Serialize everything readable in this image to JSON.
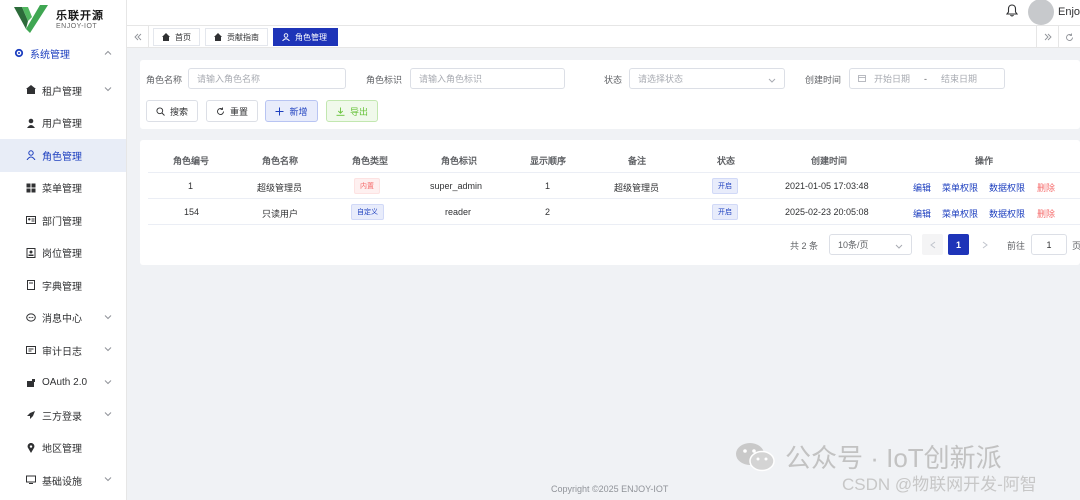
{
  "app": {
    "logo_title": "乐联开源",
    "logo_sub": "ENJOY-IOT",
    "brand_color": "#1e34b8",
    "user_name": "Enjoy"
  },
  "sidebar": {
    "group_label": "系统管理",
    "items": [
      {
        "label": "租户管理",
        "icon": "building-icon",
        "chevron": true
      },
      {
        "label": "用户管理",
        "icon": "user-icon",
        "chevron": false
      },
      {
        "label": "角色管理",
        "icon": "user-outline-icon",
        "chevron": false,
        "active": true
      },
      {
        "label": "菜单管理",
        "icon": "grid-icon",
        "chevron": false
      },
      {
        "label": "部门管理",
        "icon": "id-card-icon",
        "chevron": false
      },
      {
        "label": "岗位管理",
        "icon": "badge-icon",
        "chevron": false
      },
      {
        "label": "字典管理",
        "icon": "book-icon",
        "chevron": false
      },
      {
        "label": "消息中心",
        "icon": "chat-icon",
        "chevron": true
      },
      {
        "label": "审计日志",
        "icon": "log-icon",
        "chevron": true
      },
      {
        "label": "OAuth 2.0",
        "icon": "key-icon",
        "chevron": true
      },
      {
        "label": "三方登录",
        "icon": "rocket-icon",
        "chevron": true
      },
      {
        "label": "地区管理",
        "icon": "location-icon",
        "chevron": false
      },
      {
        "label": "基础设施",
        "icon": "monitor-icon",
        "chevron": true
      }
    ]
  },
  "tabs": [
    {
      "label": "首页"
    },
    {
      "label": "贡献指南"
    },
    {
      "label": "角色管理",
      "active": true
    }
  ],
  "search": {
    "name_label": "角色名称",
    "name_placeholder": "请输入角色名称",
    "code_label": "角色标识",
    "code_placeholder": "请输入角色标识",
    "status_label": "状态",
    "status_placeholder": "请选择状态",
    "time_label": "创建时间",
    "start_placeholder": "开始日期",
    "range_sep": "-",
    "end_placeholder": "结束日期",
    "btn_search": "搜索",
    "btn_reset": "重置",
    "btn_add": "新增",
    "btn_export": "导出"
  },
  "table": {
    "headers": [
      "角色编号",
      "角色名称",
      "角色类型",
      "角色标识",
      "显示顺序",
      "备注",
      "状态",
      "创建时间",
      "操作"
    ],
    "rows": [
      {
        "id": "1",
        "name": "超级管理员",
        "type": "内置",
        "type_style": "danger",
        "code": "super_admin",
        "sort": "1",
        "remark": "超级管理员",
        "status": "开启",
        "created": "2021-01-05 17:03:48"
      },
      {
        "id": "154",
        "name": "只读用户",
        "type": "自定义",
        "type_style": "primary",
        "code": "reader",
        "sort": "2",
        "remark": "",
        "status": "开启",
        "created": "2025-02-23 20:05:08"
      }
    ],
    "actions": [
      "编辑",
      "菜单权限",
      "数据权限",
      "删除"
    ]
  },
  "pagination": {
    "total": "共 2 条",
    "page_size": "10条/页",
    "current": "1",
    "goto_label": "前往",
    "goto_value": "1",
    "page_suffix": "页"
  },
  "footer": "Copyright ©2025 ENJOY-IOT",
  "watermark": {
    "wechat": "公众号 · IoT创新派",
    "csdn": "CSDN @物联网开发-阿智"
  }
}
